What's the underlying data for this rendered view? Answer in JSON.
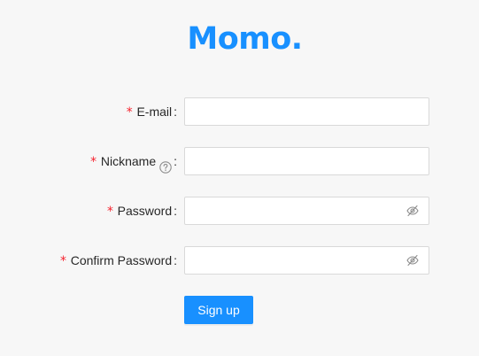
{
  "app": {
    "title": "Momo."
  },
  "form": {
    "required_mark": "*",
    "colon": ":",
    "email": {
      "label": "E-mail",
      "value": "",
      "placeholder": ""
    },
    "nickname": {
      "label": "Nickname",
      "value": "",
      "placeholder": "",
      "help_icon": "question-circle-icon"
    },
    "password": {
      "label": "Password",
      "value": "",
      "placeholder": "",
      "toggle_icon": "eye-invisible-icon"
    },
    "confirm_password": {
      "label": "Confirm Password",
      "value": "",
      "placeholder": "",
      "toggle_icon": "eye-invisible-icon"
    },
    "submit_label": "Sign up"
  },
  "colors": {
    "brand": "#1890ff",
    "required": "#f5222d",
    "background": "#f7f7f7",
    "border": "#d9d9d9"
  }
}
